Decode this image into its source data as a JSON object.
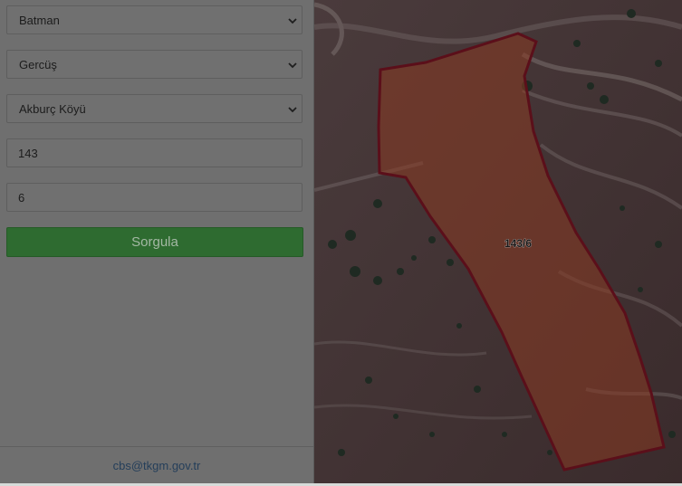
{
  "form": {
    "province": "Batman",
    "district": "Gercüş",
    "neighborhood": "Akburç Köyü",
    "block": "143",
    "parcel": "6",
    "submit_label": "Sorgula"
  },
  "footer": {
    "email": "cbs@tkgm.gov.tr"
  },
  "map": {
    "parcel_label": "143/6",
    "parcel_fill": "#8a3a22",
    "parcel_border": "#5b0f1a",
    "imagery": "satellite"
  },
  "icons": {
    "dropdown": "chevron-down-icon"
  }
}
